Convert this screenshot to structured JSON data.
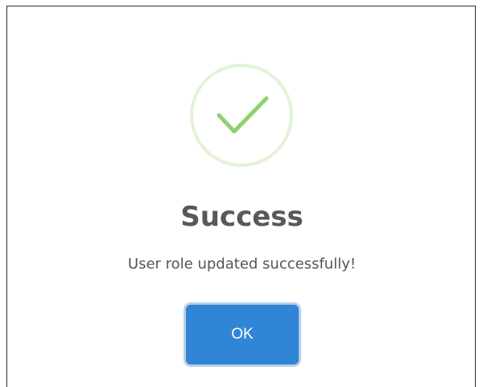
{
  "dialog": {
    "icon": "check-circle-icon",
    "title": "Success",
    "message": "User role updated successfully!",
    "ok_label": "OK"
  },
  "colors": {
    "check": "#8fd16b",
    "icon_ring": "#e2f3d8",
    "button": "#3085d6",
    "title_text": "#595959",
    "message_text": "#545454"
  }
}
